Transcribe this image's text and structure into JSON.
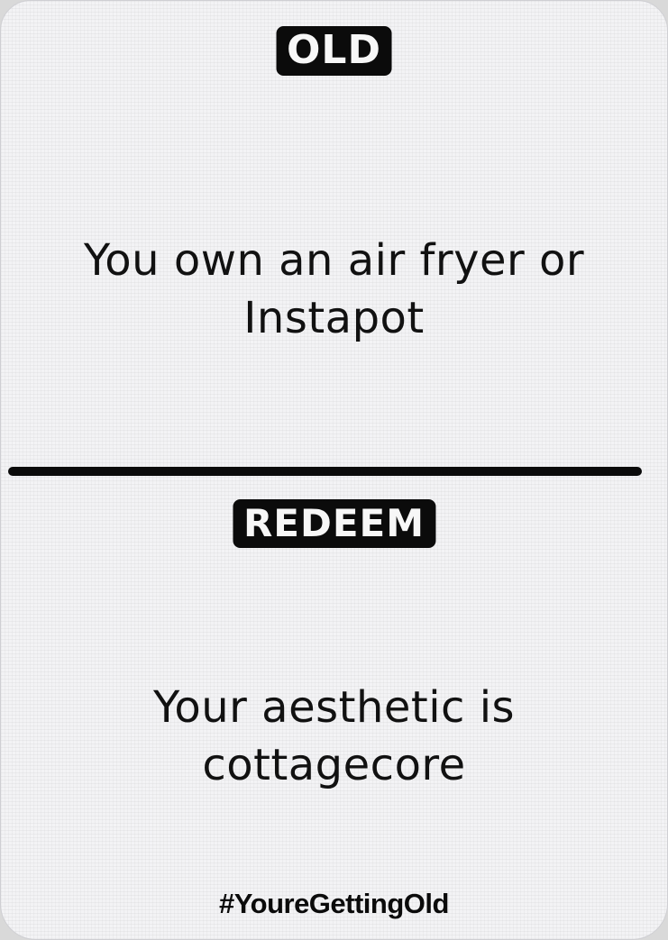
{
  "card": {
    "old_label": "OLD",
    "old_text": "You own an air fryer or Instapot",
    "redeem_label": "REDEEM",
    "redeem_text": "Your aesthetic is cottagecore",
    "hashtag": "#YoureGettingOld"
  },
  "colors": {
    "card_background": "#f3f3f5",
    "ink": "#0b0b0b",
    "pill_text": "#f7f7f7"
  }
}
